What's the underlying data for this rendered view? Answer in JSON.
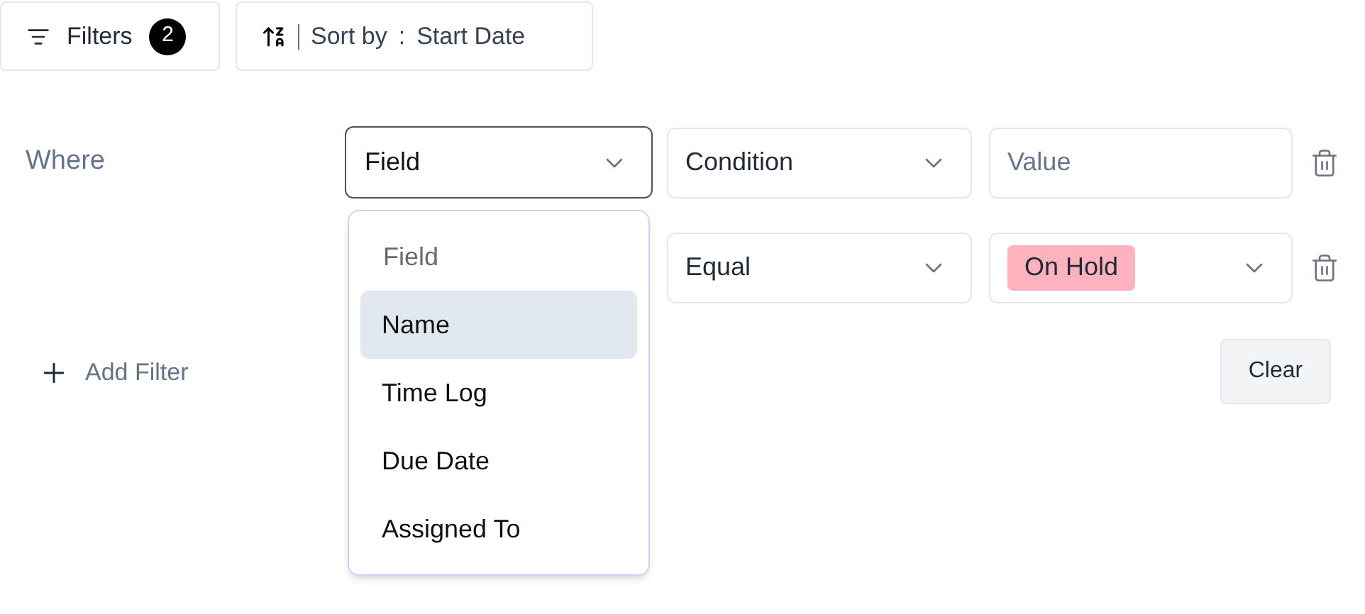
{
  "toolbar": {
    "filters": {
      "label": "Filters",
      "count": "2"
    },
    "sort": {
      "label": "Sort by",
      "separator": ":",
      "value": "Start Date"
    }
  },
  "where_label": "Where",
  "rows": [
    {
      "field": {
        "value": "Field",
        "open": true,
        "options": [
          {
            "kind": "header",
            "label": "Field",
            "highlighted": false
          },
          {
            "kind": "option",
            "label": "Name",
            "highlighted": true
          },
          {
            "kind": "option",
            "label": "Time Log",
            "highlighted": false
          },
          {
            "kind": "option",
            "label": "Due Date",
            "highlighted": false
          },
          {
            "kind": "option",
            "label": "Assigned To",
            "highlighted": false
          }
        ]
      },
      "condition": "Condition",
      "value": {
        "kind": "text",
        "placeholder": "Value"
      }
    },
    {
      "condition": "Equal",
      "value": {
        "kind": "tag",
        "text": "On Hold",
        "color": "#feb2bd"
      }
    }
  ],
  "add_filter": "Add Filter",
  "clear": "Clear"
}
